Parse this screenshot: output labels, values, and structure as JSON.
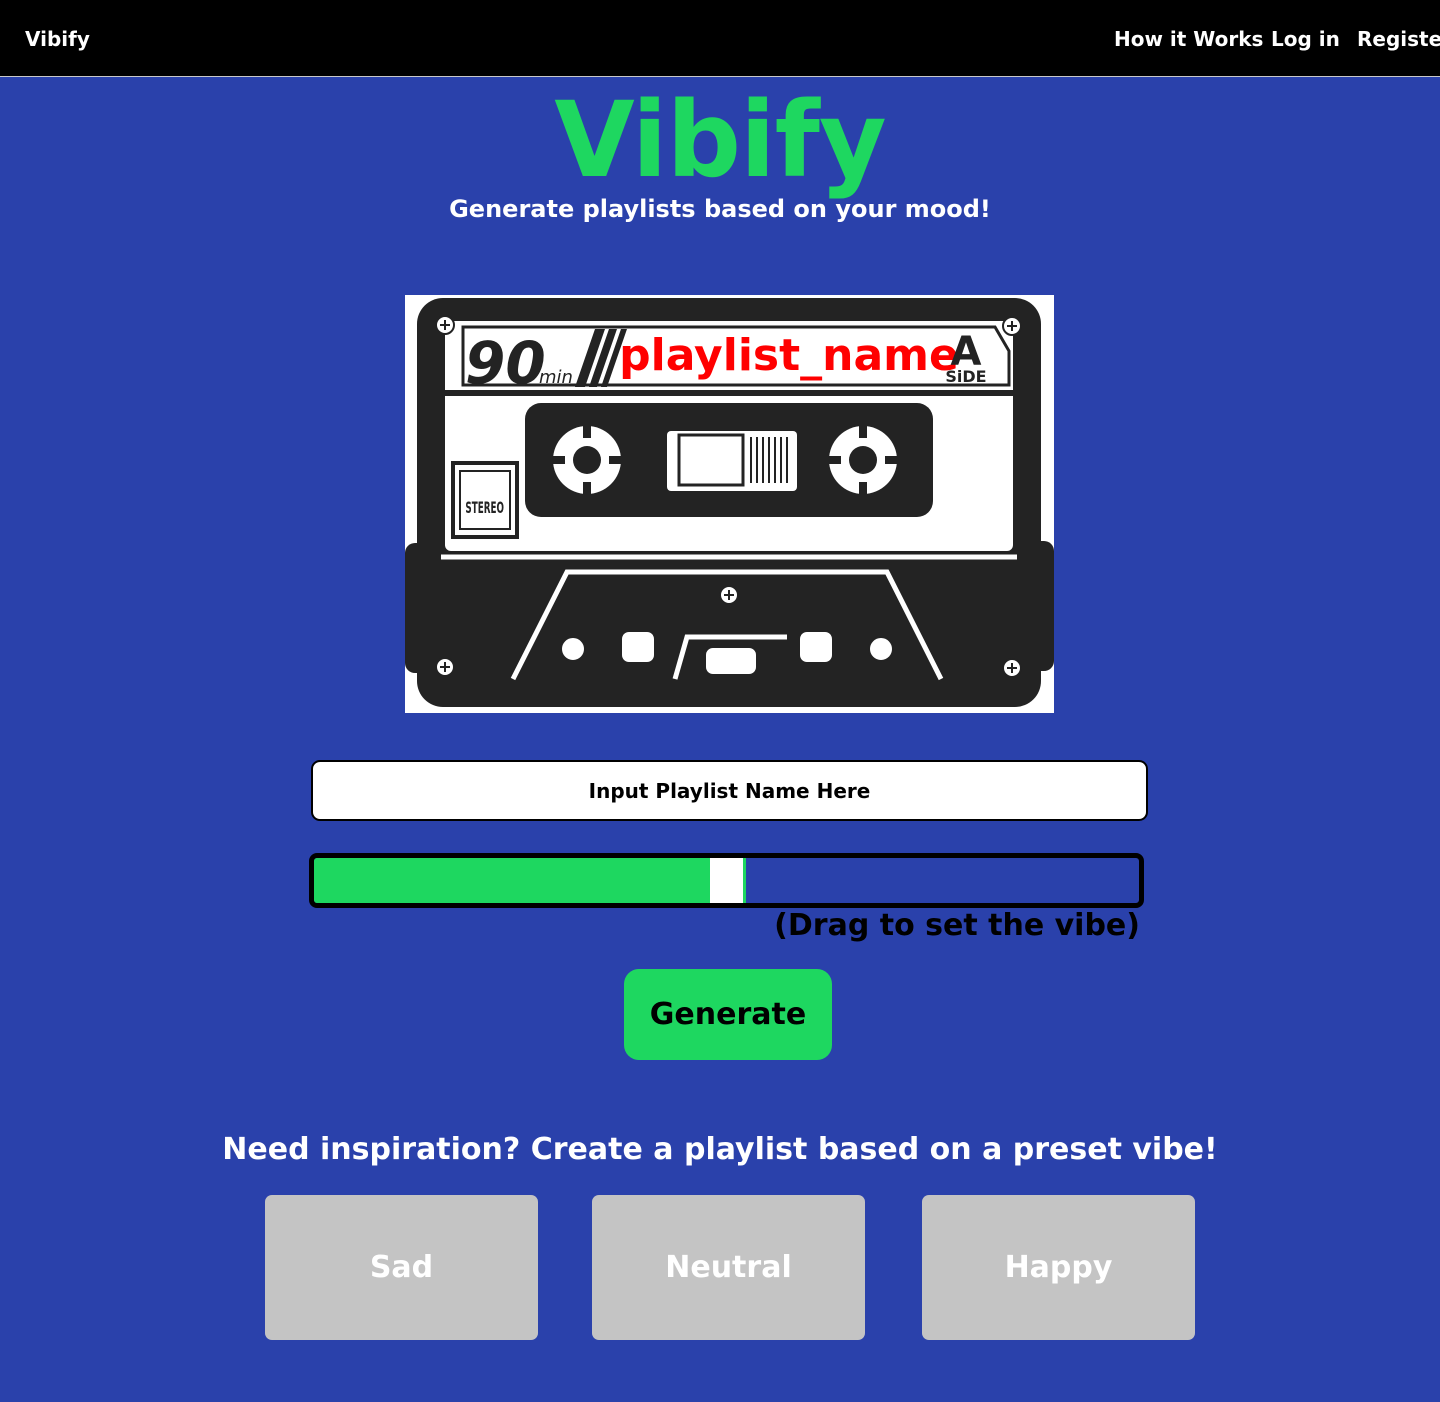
{
  "nav": {
    "brand": "Vibify",
    "links": [
      "How it Works",
      "Log in",
      "Register"
    ]
  },
  "hero": {
    "title": "Vibify",
    "subtitle": "Generate playlists based on your mood!"
  },
  "cassette": {
    "minutes": "90",
    "minutes_unit": "min",
    "playlist_label": "playlist_name",
    "side_letter": "A",
    "side_word": "SiDE",
    "stereo_label": "STEREO"
  },
  "playlist_input": {
    "placeholder": "Input Playlist Name Here",
    "value": ""
  },
  "vibe_slider": {
    "value_fraction": 0.48,
    "hint": "(Drag to set the vibe)"
  },
  "generate_button": "Generate",
  "presets": {
    "heading": "Need inspiration? Create a playlist based on a preset vibe!",
    "options": [
      "Sad",
      "Neutral",
      "Happy"
    ]
  },
  "colors": {
    "background": "#2a41ab",
    "accent": "#1ed760",
    "navbar": "#000000",
    "preset_button": "#c4c4c4",
    "label_text": "#ff0000"
  }
}
